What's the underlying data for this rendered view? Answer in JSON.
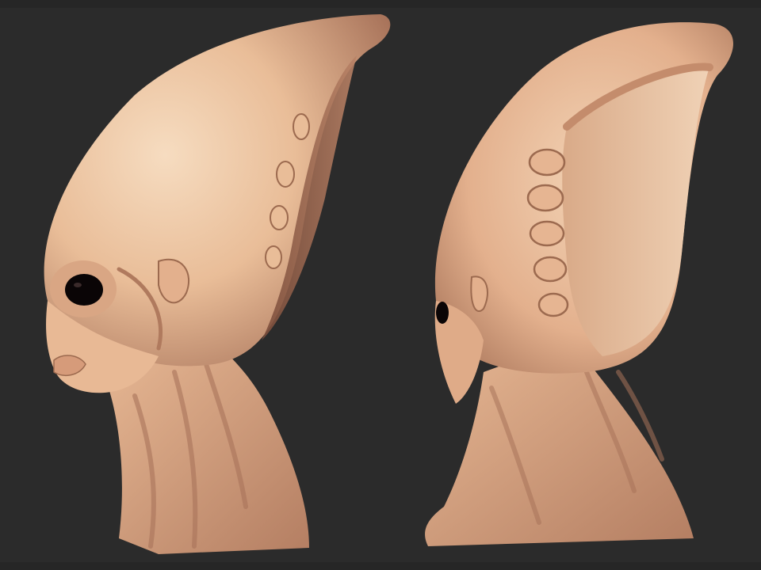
{
  "scene": {
    "colors": {
      "background": "#2b2b2b",
      "skin_light": "#f2cfae",
      "skin_mid": "#e0ae8a",
      "skin_shadow": "#9c6a4f",
      "skin_deep": "#6e4535",
      "eye": "#0a0506"
    },
    "views": [
      {
        "id": "side-view",
        "subject": "alien-head-bust"
      },
      {
        "id": "three-quarter-back-view",
        "subject": "alien-head-bust"
      }
    ]
  }
}
